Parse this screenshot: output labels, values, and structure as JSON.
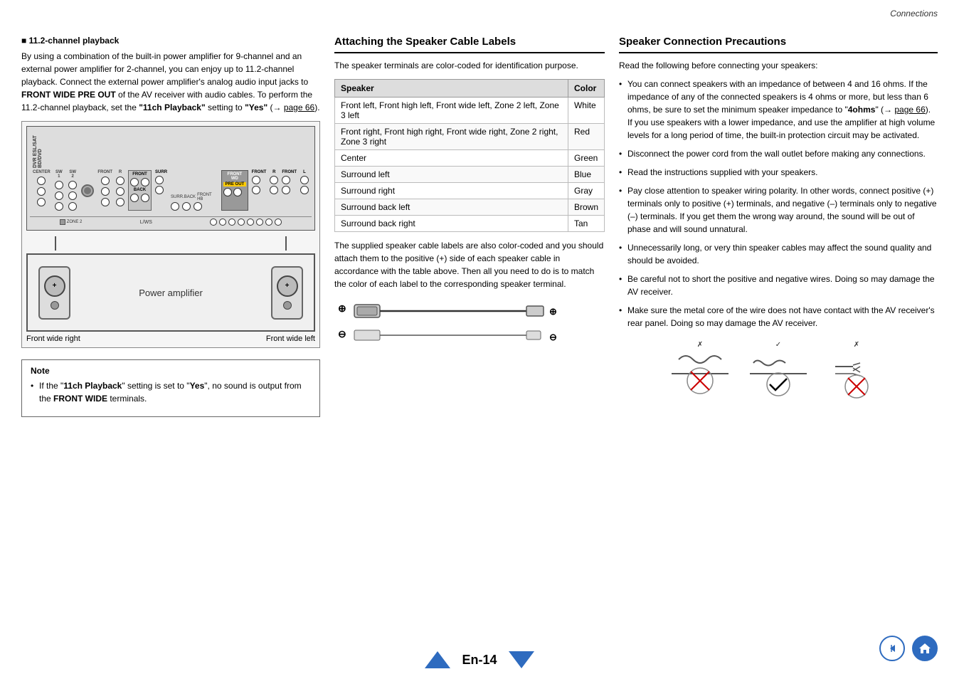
{
  "page": {
    "header": "Connections",
    "page_number": "En-14"
  },
  "left_column": {
    "subsection_title": "11.2-channel playback",
    "intro_text": "By using a combination of the built-in power amplifier for 9-channel and an external power amplifier for 2-channel, you can enjoy up to 11.2-channel playback. Connect the external power amplifier's analog audio input jacks to",
    "bold_term": "FRONT WIDE PRE OUT",
    "middle_text": "of the AV receiver with audio cables. To perform the 11.2-channel playback, set the",
    "setting_key": "\"11ch Playback\"",
    "setting_val": "\"Yes\"",
    "page_ref": "page 66",
    "diagram": {
      "power_amplifier_label": "Power amplifier",
      "front_wide_right_label": "Front wide right",
      "front_wide_left_label": "Front wide left"
    },
    "note": {
      "title": "Note",
      "bullet": "If the \"11ch Playback\" setting is set to \"Yes\", no sound is output from the FRONT WIDE terminals.",
      "bold_terms": [
        "11ch Playback",
        "Yes",
        "FRONT WIDE"
      ]
    }
  },
  "middle_column": {
    "section_title": "Attaching the Speaker Cable Labels",
    "intro_text": "The speaker terminals are color-coded for identification purpose.",
    "table": {
      "headers": [
        "Speaker",
        "Color"
      ],
      "rows": [
        {
          "speaker": "Front left, Front high left, Front wide left, Zone 2 left, Zone 3 left",
          "color": "White"
        },
        {
          "speaker": "Front right, Front high right, Front wide right, Zone 2 right, Zone 3 right",
          "color": "Red"
        },
        {
          "speaker": "Center",
          "color": "Green"
        },
        {
          "speaker": "Surround left",
          "color": "Blue"
        },
        {
          "speaker": "Surround right",
          "color": "Gray"
        },
        {
          "speaker": "Surround back left",
          "color": "Brown"
        },
        {
          "speaker": "Surround back right",
          "color": "Tan"
        }
      ]
    },
    "body_text": "The supplied speaker cable labels are also color-coded and you should attach them to the positive (+) side of each speaker cable in accordance with the table above. Then all you need to do is to match the color of each label to the corresponding speaker terminal.",
    "diagram": {
      "plus_symbol": "⊕",
      "minus_symbol": "⊖",
      "plus_right": "⊕",
      "minus_right": "⊖"
    }
  },
  "right_column": {
    "section_title": "Speaker Connection Precautions",
    "intro_text": "Read the following before connecting your speakers:",
    "bullets": [
      "You can connect speakers with an impedance of between 4 and 16 ohms. If the impedance of any of the connected speakers is 4 ohms or more, but less than 6 ohms, be sure to set the minimum speaker impedance to \"4ohms\" (→ page 66). If you use speakers with a lower impedance, and use the amplifier at high volume levels for a long period of time, the built-in protection circuit may be activated.",
      "Disconnect the power cord from the wall outlet before making any connections.",
      "Read the instructions supplied with your speakers.",
      "Pay close attention to speaker wiring polarity. In other words, connect positive (+) terminals only to positive (+) terminals, and negative (–) terminals only to negative (–) terminals. If you get them the wrong way around, the sound will be out of phase and will sound unnatural.",
      "Unnecessarily long, or very thin speaker cables may affect the sound quality and should be avoided.",
      "Be careful not to short the positive and negative wires. Doing so may damage the AV receiver.",
      "Make sure the metal core of the wire does not have contact with the AV receiver's rear panel. Doing so may damage the AV receiver."
    ],
    "page_ref_66": "page 66",
    "images_description": "Wire connector diagrams showing correct and incorrect connections with check/cross marks"
  },
  "footer": {
    "page_num_label": "En-14",
    "back_icon_title": "back",
    "home_icon_title": "home"
  }
}
